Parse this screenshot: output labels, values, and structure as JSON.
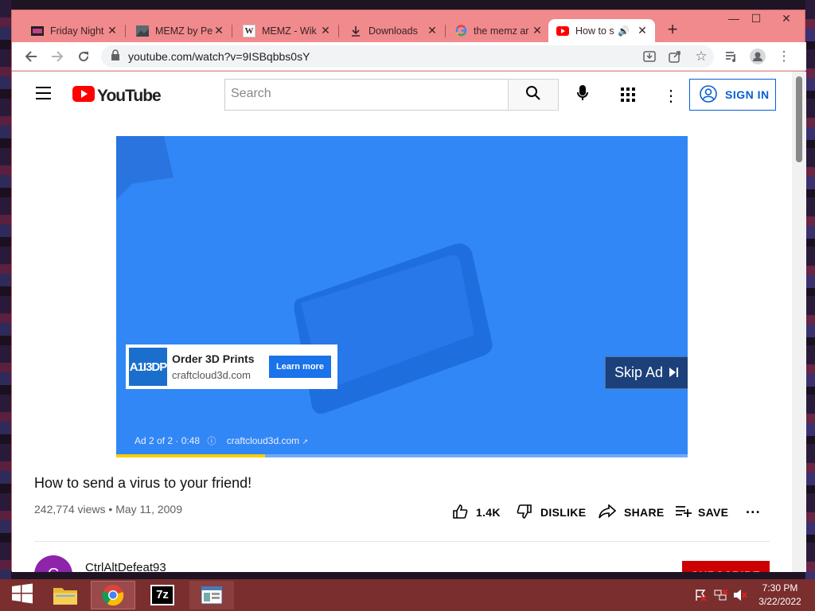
{
  "browser": {
    "tabs": [
      {
        "title": "Friday Night",
        "favicon": "fnf-icon",
        "active": false
      },
      {
        "title": "MEMZ by Pe",
        "favicon": "image-icon",
        "active": false
      },
      {
        "title": "MEMZ - Wik",
        "favicon": "wikipedia-icon",
        "active": false
      },
      {
        "title": "Downloads",
        "favicon": "download-icon",
        "active": false
      },
      {
        "title": "the memz ar",
        "favicon": "google-icon",
        "active": false
      },
      {
        "title": "How to s",
        "favicon": "youtube-icon",
        "active": true
      }
    ],
    "url": "youtube.com/watch?v=9ISBqbbs0sY",
    "new_tab_label": "+"
  },
  "youtube": {
    "logo_text": "YouTube",
    "search_placeholder": "Search",
    "sign_in_label": "SIGN IN"
  },
  "ad": {
    "logo_text": "A1I3DP",
    "title": "Order 3D Prints",
    "domain": "craftcloud3d.com",
    "cta_label": "Learn more",
    "skip_label": "Skip Ad",
    "meta_text": "Ad 2 of 2 · 0:48",
    "meta_domain": "craftcloud3d.com",
    "progress_fraction": 0.26
  },
  "video": {
    "title": "How to send a virus to your friend!",
    "views": "242,774 views",
    "date": "May 11, 2009",
    "likes": "1.4K",
    "dislike_label": "DISLIKE",
    "share_label": "SHARE",
    "save_label": "SAVE",
    "more_label": "···",
    "channel_name": "CtrlAltDefeat93",
    "channel_initial": "C",
    "subscribe_label": "SUBSCRIBE"
  },
  "taskbar": {
    "time": "7:30 PM",
    "date": "3/22/2022",
    "apps": [
      "file-explorer-icon",
      "chrome-icon",
      "7zip-icon",
      "window-app-icon"
    ],
    "sevenzip_label": "7z"
  },
  "colors": {
    "titlebar": "#f08a8c",
    "yt_red": "#ff0000",
    "ad_blue": "#3187f5",
    "taskbar": "#7a2e2e"
  }
}
